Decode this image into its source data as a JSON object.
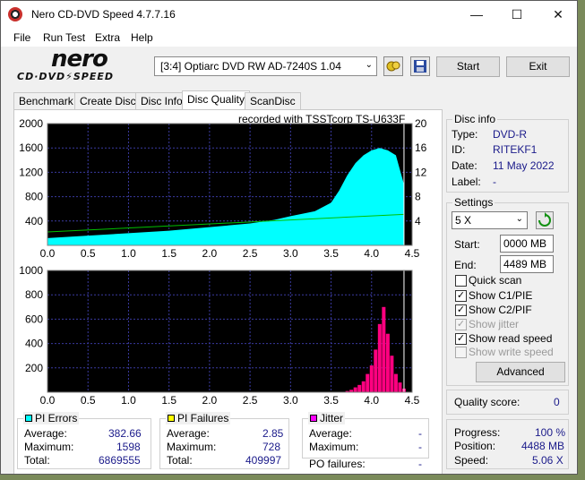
{
  "window": {
    "title": "Nero CD-DVD Speed 4.7.7.16"
  },
  "menu": [
    "File",
    "Run Test",
    "Extra",
    "Help"
  ],
  "toolbar": {
    "logo_top": "nero",
    "logo_bottom": "CD·DVD⚡SPEED",
    "drive": "[3:4]  Optiarc DVD RW AD-7240S 1.04",
    "start": "Start",
    "exit": "Exit"
  },
  "tabs": [
    "Benchmark",
    "Create Disc",
    "Disc Info",
    "Disc Quality",
    "ScanDisc"
  ],
  "active_tab": "Disc Quality",
  "recorded": "recorded with TSSTcorp TS-U633F",
  "chart_data": [
    {
      "type": "area",
      "x_ticks": [
        "0.0",
        "0.5",
        "1.0",
        "1.5",
        "2.0",
        "2.5",
        "3.0",
        "3.5",
        "4.0",
        "4.5"
      ],
      "xlim": [
        0,
        4.5
      ],
      "y_left_ticks": [
        "2000",
        "1600",
        "1200",
        "800",
        "400"
      ],
      "ylim": [
        0,
        2000
      ],
      "y_right_ticks": [
        "20",
        "16",
        "12",
        "8",
        "4"
      ],
      "y2lim": [
        0,
        20
      ],
      "series": [
        {
          "values_x": [
            0,
            0.5,
            1.0,
            1.5,
            2.0,
            2.5,
            2.8,
            3.0,
            3.3,
            3.5,
            3.6,
            3.7,
            3.8,
            3.9,
            4.0,
            4.1,
            4.2,
            4.3,
            4.4
          ],
          "values_y": [
            120,
            160,
            200,
            240,
            300,
            360,
            420,
            480,
            560,
            700,
            900,
            1150,
            1350,
            1480,
            1560,
            1600,
            1560,
            1480,
            1000
          ]
        },
        {
          "values_x": [
            0,
            4.4
          ],
          "values_y": [
            2.2,
            5.1
          ]
        }
      ],
      "colors": {
        "fill": "#00ffff",
        "speed": "#00c000",
        "bg": "#000000",
        "grid": "#3a3aa0"
      }
    },
    {
      "type": "bar",
      "x_ticks": [
        "0.0",
        "0.5",
        "1.0",
        "1.5",
        "2.0",
        "2.5",
        "3.0",
        "3.5",
        "4.0",
        "4.5"
      ],
      "xlim": [
        0,
        4.5
      ],
      "y_left_ticks": [
        "1000",
        "800",
        "600",
        "400",
        "200"
      ],
      "ylim": [
        0,
        1000
      ],
      "series": [
        {
          "values_x": [
            3.7,
            3.75,
            3.8,
            3.85,
            3.9,
            3.95,
            4.0,
            4.05,
            4.1,
            4.15,
            4.2,
            4.25,
            4.3,
            4.35,
            4.4
          ],
          "values_y": [
            10,
            20,
            40,
            60,
            90,
            150,
            220,
            350,
            560,
            700,
            480,
            300,
            150,
            80,
            30
          ]
        }
      ],
      "colors": {
        "bars": "#ff0080",
        "bg": "#000000",
        "grid": "#3a3aa0"
      }
    }
  ],
  "disc_info": {
    "title": "Disc info",
    "type_label": "Type:",
    "type": "DVD-R",
    "id_label": "ID:",
    "id": "RITEKF1",
    "date_label": "Date:",
    "date": "11 May 2022",
    "label_label": "Label:",
    "label": "-"
  },
  "settings": {
    "title": "Settings",
    "speed": "5 X",
    "start_label": "Start:",
    "start": "0000 MB",
    "end_label": "End:",
    "end": "4489 MB",
    "quick_scan": "Quick scan",
    "show_c1": "Show C1/PIE",
    "show_c2": "Show C2/PIF",
    "show_jitter": "Show jitter",
    "show_read": "Show read speed",
    "show_write": "Show write speed",
    "advanced": "Advanced"
  },
  "quality": {
    "label": "Quality score:",
    "value": "0"
  },
  "progress": {
    "progress_label": "Progress:",
    "progress": "100 %",
    "position_label": "Position:",
    "position": "4488 MB",
    "speed_label": "Speed:",
    "speed": "5.06 X"
  },
  "pi_errors": {
    "title": "PI Errors",
    "avg_label": "Average:",
    "avg": "382.66",
    "max_label": "Maximum:",
    "max": "1598",
    "total_label": "Total:",
    "total": "6869555"
  },
  "pi_failures": {
    "title": "PI Failures",
    "avg_label": "Average:",
    "avg": "2.85",
    "max_label": "Maximum:",
    "max": "728",
    "total_label": "Total:",
    "total": "409997"
  },
  "jitter": {
    "title": "Jitter",
    "avg_label": "Average:",
    "avg": "-",
    "max_label": "Maximum:",
    "max": "-",
    "po_label": "PO failures:",
    "po": "-"
  }
}
